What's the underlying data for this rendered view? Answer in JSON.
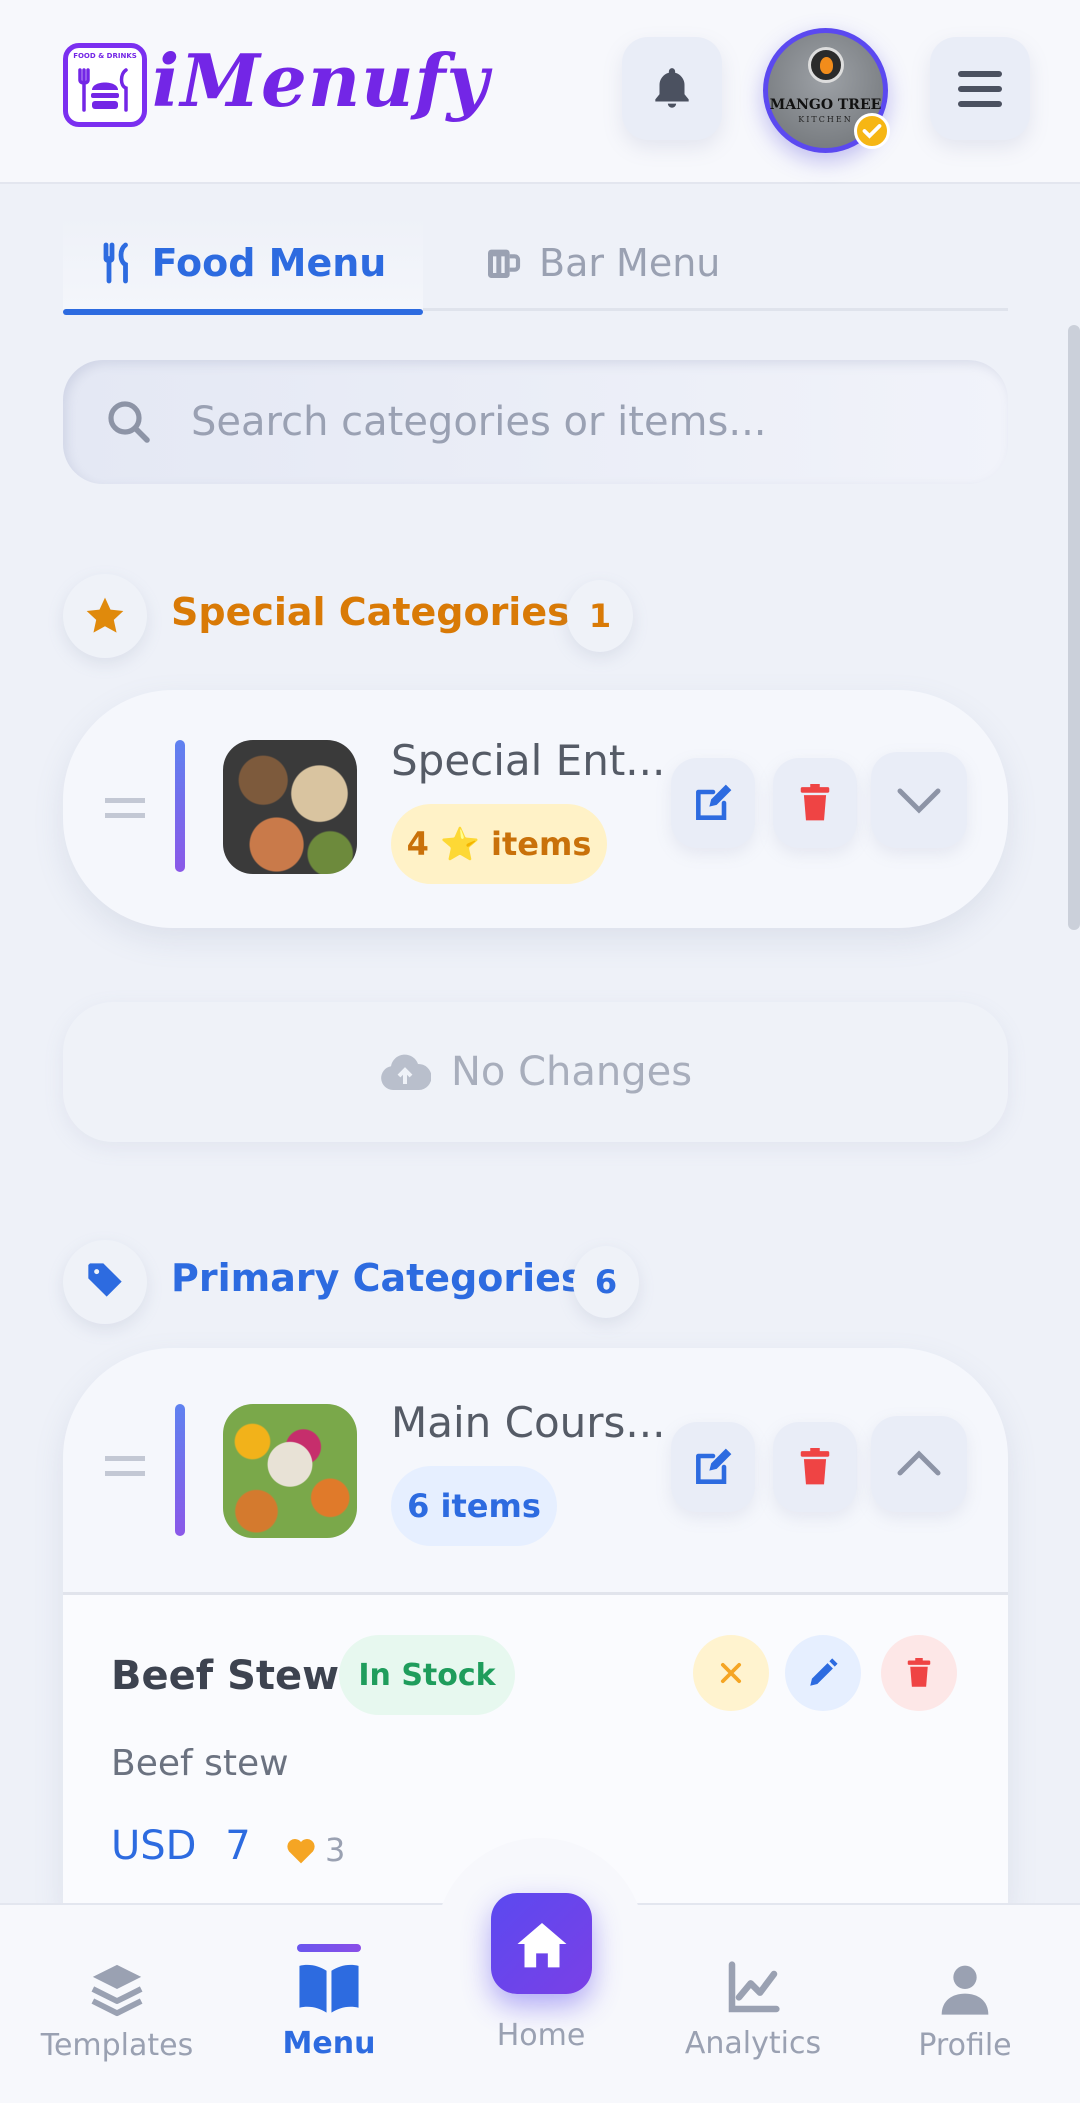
{
  "header": {
    "logo_badge_text": "FOOD & DRINKS",
    "app_name": "iMenufy",
    "avatar_label": "MANGO TREE",
    "avatar_sublabel": "KITCHEN"
  },
  "tabs": [
    {
      "label": "Food Menu",
      "active": true
    },
    {
      "label": "Bar Menu",
      "active": false
    }
  ],
  "search": {
    "placeholder": "Search categories or items..."
  },
  "special_section": {
    "title": "Special Categories",
    "count": "1",
    "accent": "#d97a06",
    "category": {
      "name": "Special Ent...",
      "badge": "4 ⭐ items"
    }
  },
  "sync": {
    "label": "No Changes"
  },
  "primary_section": {
    "title": "Primary Categories",
    "count": "6",
    "accent": "#2d6be0",
    "category": {
      "name": "Main Cours...",
      "badge": "6 items"
    }
  },
  "item": {
    "name": "Beef Stew",
    "status": "In Stock",
    "description": "Beef stew",
    "currency": "USD",
    "price": "7",
    "likes": "3"
  },
  "bottom_nav": [
    {
      "label": "Templates",
      "icon": "layers-icon"
    },
    {
      "label": "Menu",
      "icon": "book-icon",
      "active": true
    },
    {
      "label": "Home",
      "icon": "home-icon"
    },
    {
      "label": "Analytics",
      "icon": "chart-icon"
    },
    {
      "label": "Profile",
      "icon": "user-icon"
    }
  ]
}
